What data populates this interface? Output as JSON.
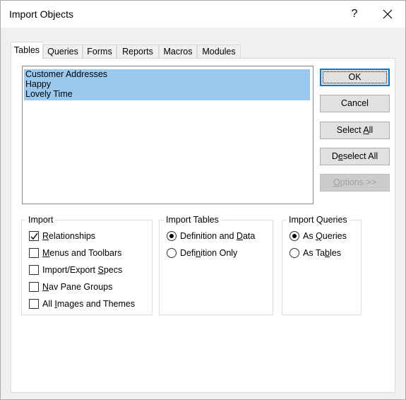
{
  "window": {
    "title": "Import Objects",
    "help": "?",
    "close": "✕"
  },
  "tabs": [
    {
      "label": "Tables",
      "active": true
    },
    {
      "label": "Queries"
    },
    {
      "label": "Forms"
    },
    {
      "label": "Reports"
    },
    {
      "label": "Macros"
    },
    {
      "label": "Modules"
    }
  ],
  "list": {
    "items": [
      "Customer Addresses",
      "Happy",
      "Lovely Time"
    ],
    "selected": [
      true,
      true,
      true
    ]
  },
  "buttons": {
    "ok": "OK",
    "cancel": "Cancel",
    "select_all": {
      "pre": "Select ",
      "ul": "A",
      "post": "ll"
    },
    "deselect_all": {
      "pre": "D",
      "ul": "e",
      "post": "select All"
    },
    "options": {
      "pre": "",
      "ul": "O",
      "post": "ptions >>"
    }
  },
  "import_group": {
    "legend": "Import",
    "options": [
      {
        "pre": "",
        "ul": "R",
        "post": "elationships",
        "checked": true
      },
      {
        "pre": "",
        "ul": "M",
        "post": "enus and Toolbars",
        "checked": false
      },
      {
        "pre": "Import/Export ",
        "ul": "S",
        "post": "pecs",
        "checked": false
      },
      {
        "pre": "",
        "ul": "N",
        "post": "av Pane Groups",
        "checked": false
      },
      {
        "pre": "All ",
        "ul": "I",
        "post": "mages and Themes",
        "checked": false
      }
    ]
  },
  "import_tables": {
    "legend": "Import Tables",
    "options": [
      {
        "pre": "Definition and ",
        "ul": "D",
        "post": "ata",
        "selected": true
      },
      {
        "pre": "Defi",
        "ul": "n",
        "post": "ition Only",
        "selected": false
      }
    ]
  },
  "import_queries": {
    "legend": "Import Queries",
    "options": [
      {
        "pre": "As ",
        "ul": "Q",
        "post": "ueries",
        "selected": true
      },
      {
        "pre": "As Ta",
        "ul": "b",
        "post": "les",
        "selected": false
      }
    ]
  }
}
